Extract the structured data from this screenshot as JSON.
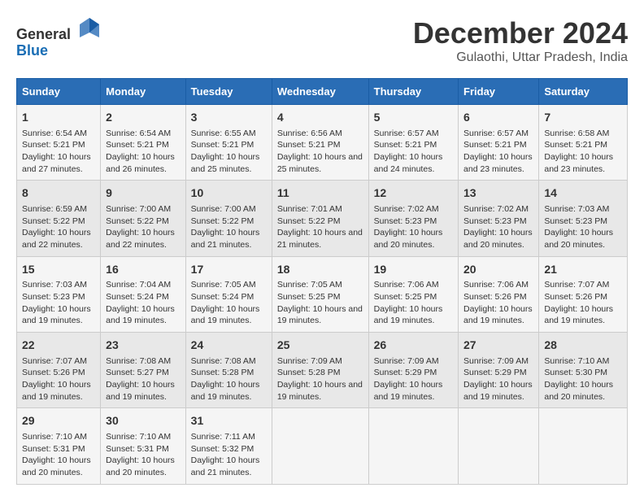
{
  "logo": {
    "general": "General",
    "blue": "Blue"
  },
  "title": "December 2024",
  "location": "Gulaothi, Uttar Pradesh, India",
  "days_of_week": [
    "Sunday",
    "Monday",
    "Tuesday",
    "Wednesday",
    "Thursday",
    "Friday",
    "Saturday"
  ],
  "weeks": [
    [
      {
        "day": "1",
        "sunrise": "Sunrise: 6:54 AM",
        "sunset": "Sunset: 5:21 PM",
        "daylight": "Daylight: 10 hours and 27 minutes."
      },
      {
        "day": "2",
        "sunrise": "Sunrise: 6:54 AM",
        "sunset": "Sunset: 5:21 PM",
        "daylight": "Daylight: 10 hours and 26 minutes."
      },
      {
        "day": "3",
        "sunrise": "Sunrise: 6:55 AM",
        "sunset": "Sunset: 5:21 PM",
        "daylight": "Daylight: 10 hours and 25 minutes."
      },
      {
        "day": "4",
        "sunrise": "Sunrise: 6:56 AM",
        "sunset": "Sunset: 5:21 PM",
        "daylight": "Daylight: 10 hours and 25 minutes."
      },
      {
        "day": "5",
        "sunrise": "Sunrise: 6:57 AM",
        "sunset": "Sunset: 5:21 PM",
        "daylight": "Daylight: 10 hours and 24 minutes."
      },
      {
        "day": "6",
        "sunrise": "Sunrise: 6:57 AM",
        "sunset": "Sunset: 5:21 PM",
        "daylight": "Daylight: 10 hours and 23 minutes."
      },
      {
        "day": "7",
        "sunrise": "Sunrise: 6:58 AM",
        "sunset": "Sunset: 5:21 PM",
        "daylight": "Daylight: 10 hours and 23 minutes."
      }
    ],
    [
      {
        "day": "8",
        "sunrise": "Sunrise: 6:59 AM",
        "sunset": "Sunset: 5:22 PM",
        "daylight": "Daylight: 10 hours and 22 minutes."
      },
      {
        "day": "9",
        "sunrise": "Sunrise: 7:00 AM",
        "sunset": "Sunset: 5:22 PM",
        "daylight": "Daylight: 10 hours and 22 minutes."
      },
      {
        "day": "10",
        "sunrise": "Sunrise: 7:00 AM",
        "sunset": "Sunset: 5:22 PM",
        "daylight": "Daylight: 10 hours and 21 minutes."
      },
      {
        "day": "11",
        "sunrise": "Sunrise: 7:01 AM",
        "sunset": "Sunset: 5:22 PM",
        "daylight": "Daylight: 10 hours and 21 minutes."
      },
      {
        "day": "12",
        "sunrise": "Sunrise: 7:02 AM",
        "sunset": "Sunset: 5:23 PM",
        "daylight": "Daylight: 10 hours and 20 minutes."
      },
      {
        "day": "13",
        "sunrise": "Sunrise: 7:02 AM",
        "sunset": "Sunset: 5:23 PM",
        "daylight": "Daylight: 10 hours and 20 minutes."
      },
      {
        "day": "14",
        "sunrise": "Sunrise: 7:03 AM",
        "sunset": "Sunset: 5:23 PM",
        "daylight": "Daylight: 10 hours and 20 minutes."
      }
    ],
    [
      {
        "day": "15",
        "sunrise": "Sunrise: 7:03 AM",
        "sunset": "Sunset: 5:23 PM",
        "daylight": "Daylight: 10 hours and 19 minutes."
      },
      {
        "day": "16",
        "sunrise": "Sunrise: 7:04 AM",
        "sunset": "Sunset: 5:24 PM",
        "daylight": "Daylight: 10 hours and 19 minutes."
      },
      {
        "day": "17",
        "sunrise": "Sunrise: 7:05 AM",
        "sunset": "Sunset: 5:24 PM",
        "daylight": "Daylight: 10 hours and 19 minutes."
      },
      {
        "day": "18",
        "sunrise": "Sunrise: 7:05 AM",
        "sunset": "Sunset: 5:25 PM",
        "daylight": "Daylight: 10 hours and 19 minutes."
      },
      {
        "day": "19",
        "sunrise": "Sunrise: 7:06 AM",
        "sunset": "Sunset: 5:25 PM",
        "daylight": "Daylight: 10 hours and 19 minutes."
      },
      {
        "day": "20",
        "sunrise": "Sunrise: 7:06 AM",
        "sunset": "Sunset: 5:26 PM",
        "daylight": "Daylight: 10 hours and 19 minutes."
      },
      {
        "day": "21",
        "sunrise": "Sunrise: 7:07 AM",
        "sunset": "Sunset: 5:26 PM",
        "daylight": "Daylight: 10 hours and 19 minutes."
      }
    ],
    [
      {
        "day": "22",
        "sunrise": "Sunrise: 7:07 AM",
        "sunset": "Sunset: 5:26 PM",
        "daylight": "Daylight: 10 hours and 19 minutes."
      },
      {
        "day": "23",
        "sunrise": "Sunrise: 7:08 AM",
        "sunset": "Sunset: 5:27 PM",
        "daylight": "Daylight: 10 hours and 19 minutes."
      },
      {
        "day": "24",
        "sunrise": "Sunrise: 7:08 AM",
        "sunset": "Sunset: 5:28 PM",
        "daylight": "Daylight: 10 hours and 19 minutes."
      },
      {
        "day": "25",
        "sunrise": "Sunrise: 7:09 AM",
        "sunset": "Sunset: 5:28 PM",
        "daylight": "Daylight: 10 hours and 19 minutes."
      },
      {
        "day": "26",
        "sunrise": "Sunrise: 7:09 AM",
        "sunset": "Sunset: 5:29 PM",
        "daylight": "Daylight: 10 hours and 19 minutes."
      },
      {
        "day": "27",
        "sunrise": "Sunrise: 7:09 AM",
        "sunset": "Sunset: 5:29 PM",
        "daylight": "Daylight: 10 hours and 19 minutes."
      },
      {
        "day": "28",
        "sunrise": "Sunrise: 7:10 AM",
        "sunset": "Sunset: 5:30 PM",
        "daylight": "Daylight: 10 hours and 20 minutes."
      }
    ],
    [
      {
        "day": "29",
        "sunrise": "Sunrise: 7:10 AM",
        "sunset": "Sunset: 5:31 PM",
        "daylight": "Daylight: 10 hours and 20 minutes."
      },
      {
        "day": "30",
        "sunrise": "Sunrise: 7:10 AM",
        "sunset": "Sunset: 5:31 PM",
        "daylight": "Daylight: 10 hours and 20 minutes."
      },
      {
        "day": "31",
        "sunrise": "Sunrise: 7:11 AM",
        "sunset": "Sunset: 5:32 PM",
        "daylight": "Daylight: 10 hours and 21 minutes."
      },
      null,
      null,
      null,
      null
    ]
  ]
}
